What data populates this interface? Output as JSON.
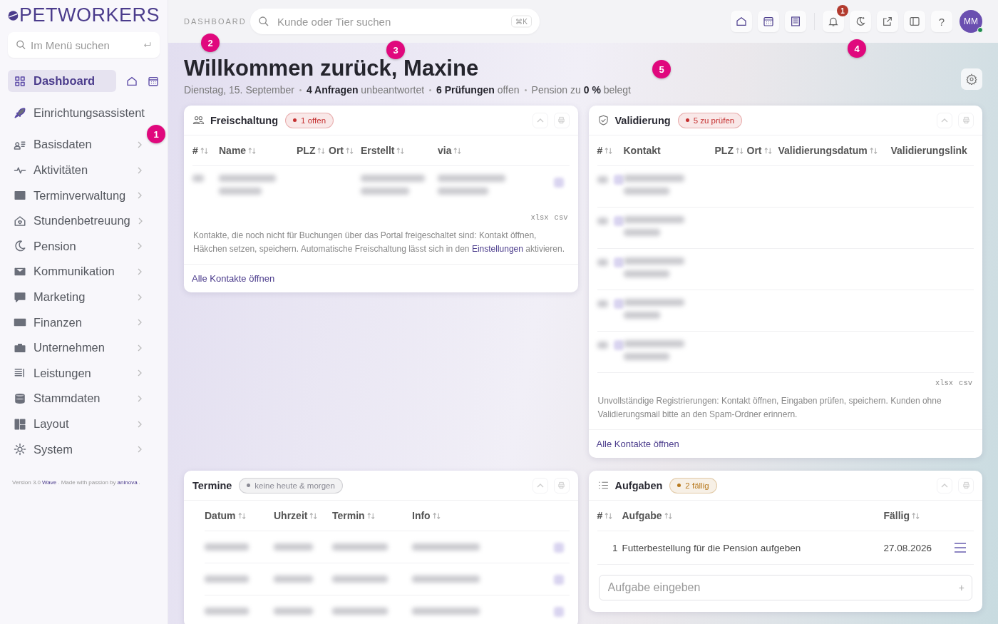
{
  "sidebar": {
    "logo": "PETWORKERS",
    "search": {
      "placeholder": "Im Menü suchen"
    },
    "items": [
      {
        "label": "Dashboard",
        "selected": true,
        "kind": "dashboard"
      },
      {
        "label": "Einrichtungsassistent",
        "selected": false,
        "kind": "plain"
      },
      {
        "label": "Basisdaten",
        "selected": false,
        "kind": "group"
      },
      {
        "label": "Aktivitäten",
        "selected": false,
        "kind": "group"
      },
      {
        "label": "Terminverwaltung",
        "selected": false,
        "kind": "group"
      },
      {
        "label": "Stundenbetreuung",
        "selected": false,
        "kind": "group"
      },
      {
        "label": "Pension",
        "selected": false,
        "kind": "group"
      },
      {
        "label": "Kommunikation",
        "selected": false,
        "kind": "group"
      },
      {
        "label": "Marketing",
        "selected": false,
        "kind": "group"
      },
      {
        "label": "Finanzen",
        "selected": false,
        "kind": "group"
      },
      {
        "label": "Unternehmen",
        "selected": false,
        "kind": "group"
      },
      {
        "label": "Leistungen",
        "selected": false,
        "kind": "group"
      },
      {
        "label": "Stammdaten",
        "selected": false,
        "kind": "group"
      },
      {
        "label": "Layout",
        "selected": false,
        "kind": "group"
      },
      {
        "label": "System",
        "selected": false,
        "kind": "group"
      }
    ],
    "footer": [
      {
        "text": "Version 3.0",
        "kind": "text"
      },
      {
        "text": "Wave",
        "kind": "link"
      },
      {
        "text": ". Made with passion by",
        "kind": "text"
      },
      {
        "text": "aninova",
        "kind": "link"
      },
      {
        "text": ".",
        "kind": "text"
      }
    ]
  },
  "header": {
    "breadcrumb": "DASHBOARD",
    "search": {
      "placeholder": "Kunde oder Tier suchen",
      "shortcut": "⌘K"
    },
    "notification_count": "1",
    "help": "?",
    "avatar": {
      "initials": "MM",
      "online": true
    }
  },
  "welcome": {
    "title": "Willkommen zurück, Maxine",
    "facts": [
      "Dienstag, 15. September",
      "**4 Anfragen** unbeantwortet",
      "**6 Prüfungen** offen",
      "Pension zu **0 %** belegt"
    ]
  },
  "cards": [
    {
      "kind": "contacts",
      "title": "Freischaltung",
      "badge": {
        "text": "1 offen",
        "color": "#c53030"
      },
      "columns": [
        {
          "label": "#",
          "sortable": true
        },
        {
          "label": "Name",
          "sortable": true
        },
        {
          "label": "PLZ",
          "sortable": true
        },
        {
          "label": "Ort",
          "sortable": true
        },
        {
          "label": "Erstellt",
          "sortable": true
        },
        {
          "label": "via",
          "sortable": true
        }
      ],
      "rows": [
        {
          "kind": "blurred"
        }
      ],
      "exports": [
        "xlsx",
        "csv"
      ],
      "note": [
        {
          "text": "Kontakte, die noch nicht für Buchungen über das Portal freigeschaltet sind: Kontakt öffnen, Häkchen setzen, speichern. Automatische Freischaltung lässt sich in den ",
          "kind": "text"
        },
        {
          "text": "Einstellungen",
          "kind": "link"
        },
        {
          "text": " aktivieren.",
          "kind": "text"
        }
      ],
      "link": "Alle Kontakte öffnen"
    },
    {
      "kind": "contacts",
      "title": "Validierung",
      "badge": {
        "text": "5 zu prüfen",
        "color": "#c53030"
      },
      "columns": [
        {
          "label": "#",
          "sortable": true
        },
        {
          "label": "Kontakt",
          "sortable": false
        },
        {
          "label": "PLZ",
          "sortable": true
        },
        {
          "label": "Ort",
          "sortable": true
        },
        {
          "label": "Validierungsdatum",
          "sortable": true
        },
        {
          "label": "Validierungslink",
          "sortable": false
        }
      ],
      "rows": [
        {
          "kind": "blurred"
        },
        {
          "kind": "blurred"
        },
        {
          "kind": "blurred"
        },
        {
          "kind": "blurred"
        },
        {
          "kind": "blurred"
        }
      ],
      "exports": [
        "xlsx",
        "csv"
      ],
      "note": [
        {
          "text": "Unvollständige Registrierungen: Kontakt öffnen, Eingaben prüfen, speichern. Kunden ohne Validierungsmail bitte an den Spam-Ordner erinnern.",
          "kind": "text"
        }
      ],
      "link": "Alle Kontakte öffnen"
    },
    {
      "kind": "appointments",
      "title": "Termine",
      "badge": {
        "text": "keine heute & morgen",
        "color": "#8a8a94"
      },
      "columns": [
        {
          "label": "Datum",
          "sortable": true
        },
        {
          "label": "Uhrzeit",
          "sortable": true
        },
        {
          "label": "Termin",
          "sortable": true
        },
        {
          "label": "Info",
          "sortable": true
        }
      ],
      "rows": [
        {
          "kind": "blurred"
        },
        {
          "kind": "blurred"
        },
        {
          "kind": "blurred"
        }
      ]
    },
    {
      "kind": "tasks",
      "title": "Aufgaben",
      "badge": {
        "text": "2 fällig",
        "color": "#b7791f"
      },
      "columns": [
        {
          "label": "#",
          "sortable": true
        },
        {
          "label": "Aufgabe",
          "sortable": true
        },
        {
          "label": "Fällig",
          "sortable": true
        }
      ],
      "rows": [
        {
          "kind": "task",
          "number": "1",
          "task": "Futterbestellung für die Pension aufgeben",
          "due": "27.08.2026"
        }
      ],
      "input": {
        "placeholder": "Aufgabe eingeben",
        "action": "+"
      }
    }
  ],
  "callouts": [
    "1",
    "2",
    "3",
    "4",
    "5"
  ]
}
